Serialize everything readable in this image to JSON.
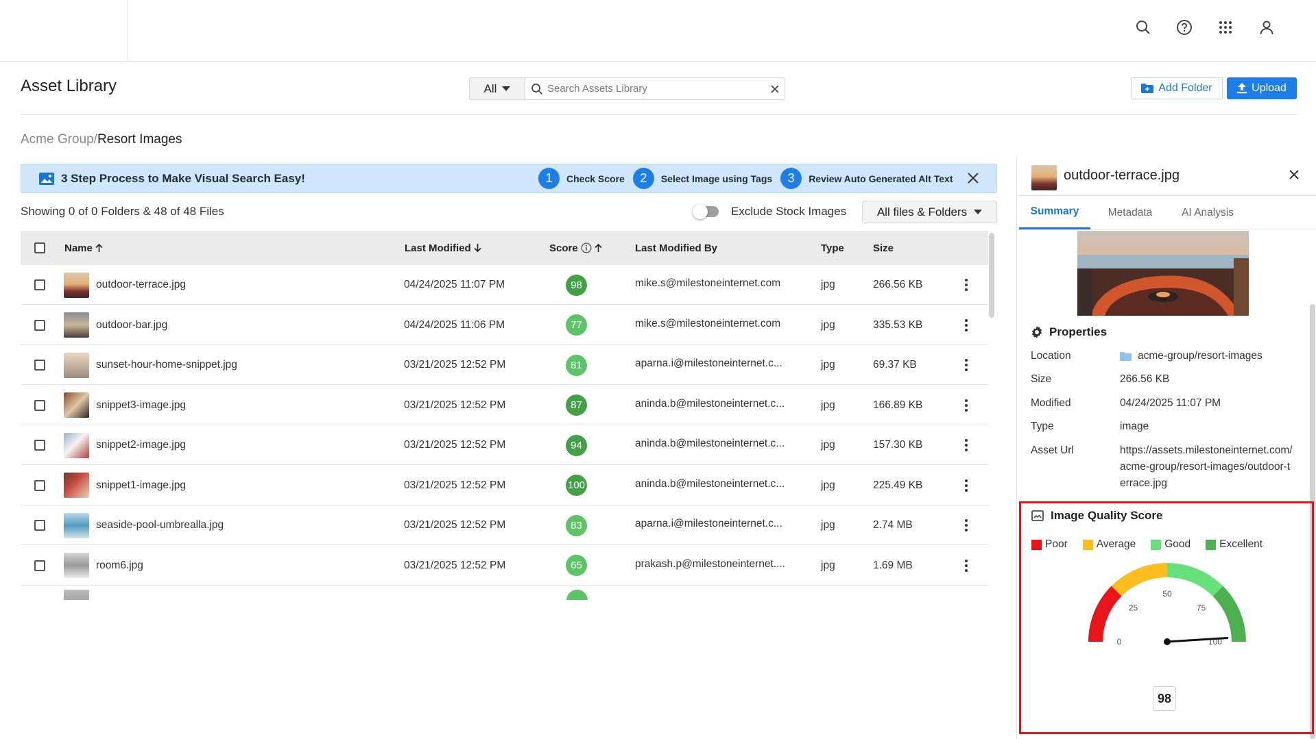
{
  "topbar": {
    "icons": [
      "search-icon",
      "help-icon",
      "apps-grid-icon",
      "user-icon"
    ]
  },
  "header": {
    "title": "Asset Library",
    "filter_value": "All",
    "search_placeholder": "Search Assets Library",
    "add_folder_label": "Add Folder",
    "upload_label": "Upload"
  },
  "breadcrumb": {
    "root": "Acme Group/",
    "current": "Resort Images"
  },
  "banner": {
    "title": "3 Step Process to Make Visual Search Easy!",
    "steps": [
      {
        "num": "1",
        "label": "Check Score"
      },
      {
        "num": "2",
        "label": "Select Image using Tags"
      },
      {
        "num": "3",
        "label": "Review Auto Generated Alt Text"
      }
    ]
  },
  "listing": {
    "showing": "Showing 0 of 0 Folders & 48 of 48 Files",
    "exclude_stock_label": "Exclude Stock Images",
    "exclude_stock_on": false,
    "files_filter": "All files & Folders"
  },
  "table": {
    "columns": {
      "name": "Name",
      "last_modified": "Last Modified",
      "score": "Score",
      "modified_by": "Last Modified By",
      "type": "Type",
      "size": "Size"
    },
    "rows": [
      {
        "name": "outdoor-terrace.jpg",
        "modified": "04/24/2025 11:07 PM",
        "score": "98",
        "by": "mike.s@milestoneinternet.com",
        "type": "jpg",
        "size": "266.56 KB"
      },
      {
        "name": "outdoor-bar.jpg",
        "modified": "04/24/2025 11:06 PM",
        "score": "77",
        "by": "mike.s@milestoneinternet.com",
        "type": "jpg",
        "size": "335.53 KB"
      },
      {
        "name": "sunset-hour-home-snippet.jpg",
        "modified": "03/21/2025 12:52 PM",
        "score": "81",
        "by": "aparna.i@milestoneinternet.c...",
        "type": "jpg",
        "size": "69.37 KB"
      },
      {
        "name": "snippet3-image.jpg",
        "modified": "03/21/2025 12:52 PM",
        "score": "87",
        "by": "aninda.b@milestoneinternet.c...",
        "type": "jpg",
        "size": "166.89 KB"
      },
      {
        "name": "snippet2-image.jpg",
        "modified": "03/21/2025 12:52 PM",
        "score": "94",
        "by": "aninda.b@milestoneinternet.c...",
        "type": "jpg",
        "size": "157.30 KB"
      },
      {
        "name": "snippet1-image.jpg",
        "modified": "03/21/2025 12:52 PM",
        "score": "100",
        "by": "aninda.b@milestoneinternet.c...",
        "type": "jpg",
        "size": "225.49 KB"
      },
      {
        "name": "seaside-pool-umbrealla.jpg",
        "modified": "03/21/2025 12:52 PM",
        "score": "83",
        "by": "aparna.i@milestoneinternet.c...",
        "type": "jpg",
        "size": "2.74 MB"
      },
      {
        "name": "room6.jpg",
        "modified": "03/21/2025 12:52 PM",
        "score": "65",
        "by": "prakash.p@milestoneinternet....",
        "type": "jpg",
        "size": "1.69 MB"
      }
    ]
  },
  "panel": {
    "file_name": "outdoor-terrace.jpg",
    "tabs": [
      "Summary",
      "Metadata",
      "AI Analysis"
    ],
    "active_tab": "Summary",
    "properties_title": "Properties",
    "properties": {
      "location_label": "Location",
      "location": "acme-group/resort-images",
      "size_label": "Size",
      "size": "266.56 KB",
      "modified_label": "Modified",
      "modified": "04/24/2025 11:07 PM",
      "type_label": "Type",
      "type": "image",
      "url_label": "Asset Url",
      "url": "https://assets.milestoneinternet.com/acme-group/resort-images/outdoor-terrace.jpg"
    },
    "quality": {
      "title": "Image Quality Score",
      "legend": [
        {
          "label": "Poor",
          "color": "#e8141a"
        },
        {
          "label": "Average",
          "color": "#fbbd1f"
        },
        {
          "label": "Good",
          "color": "#66e07a"
        },
        {
          "label": "Excellent",
          "color": "#4caf50"
        }
      ],
      "ticks": [
        "0",
        "25",
        "50",
        "75",
        "100"
      ],
      "value": "98",
      "score": 98
    }
  },
  "colors": {
    "accent": "#1c7ee6",
    "score_green": "#43a047",
    "score_light_green": "#5cc466"
  }
}
